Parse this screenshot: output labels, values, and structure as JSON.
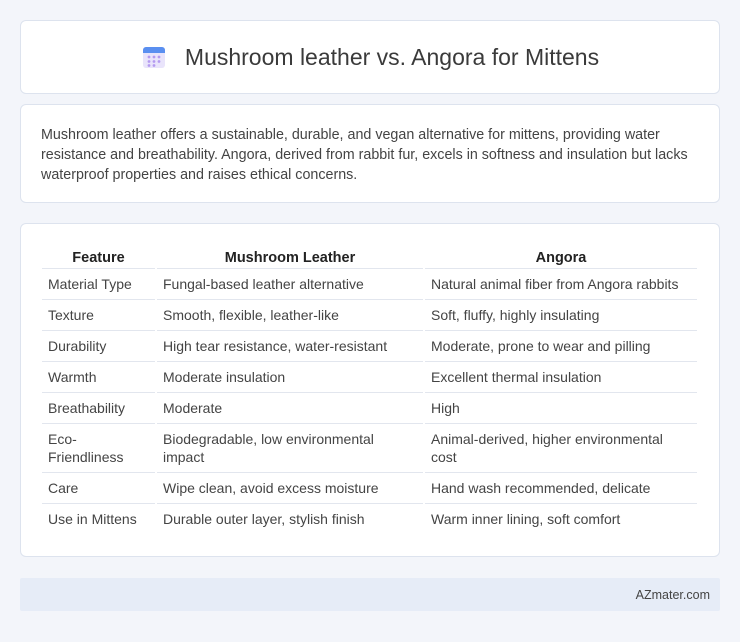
{
  "header": {
    "icon": "calendar-icon",
    "title": "Mushroom leather vs. Angora for Mittens"
  },
  "intro": {
    "text": "Mushroom leather offers a sustainable, durable, and vegan alternative for mittens, providing water resistance and breathability. Angora, derived from rabbit fur, excels in softness and insulation but lacks waterproof properties and raises ethical concerns."
  },
  "table": {
    "headers": [
      "Feature",
      "Mushroom Leather",
      "Angora"
    ],
    "rows": [
      [
        "Material Type",
        "Fungal-based leather alternative",
        "Natural animal fiber from Angora rabbits"
      ],
      [
        "Texture",
        "Smooth, flexible, leather-like",
        "Soft, fluffy, highly insulating"
      ],
      [
        "Durability",
        "High tear resistance, water-resistant",
        "Moderate, prone to wear and pilling"
      ],
      [
        "Warmth",
        "Moderate insulation",
        "Excellent thermal insulation"
      ],
      [
        "Breathability",
        "Moderate",
        "High"
      ],
      [
        "Eco-Friendliness",
        "Biodegradable, low environmental impact",
        "Animal-derived, higher environmental cost"
      ],
      [
        "Care",
        "Wipe clean, avoid excess moisture",
        "Hand wash recommended, delicate"
      ],
      [
        "Use in Mittens",
        "Durable outer layer, stylish finish",
        "Warm inner lining, soft comfort"
      ]
    ]
  },
  "footer": {
    "text": "AZmater.com"
  }
}
